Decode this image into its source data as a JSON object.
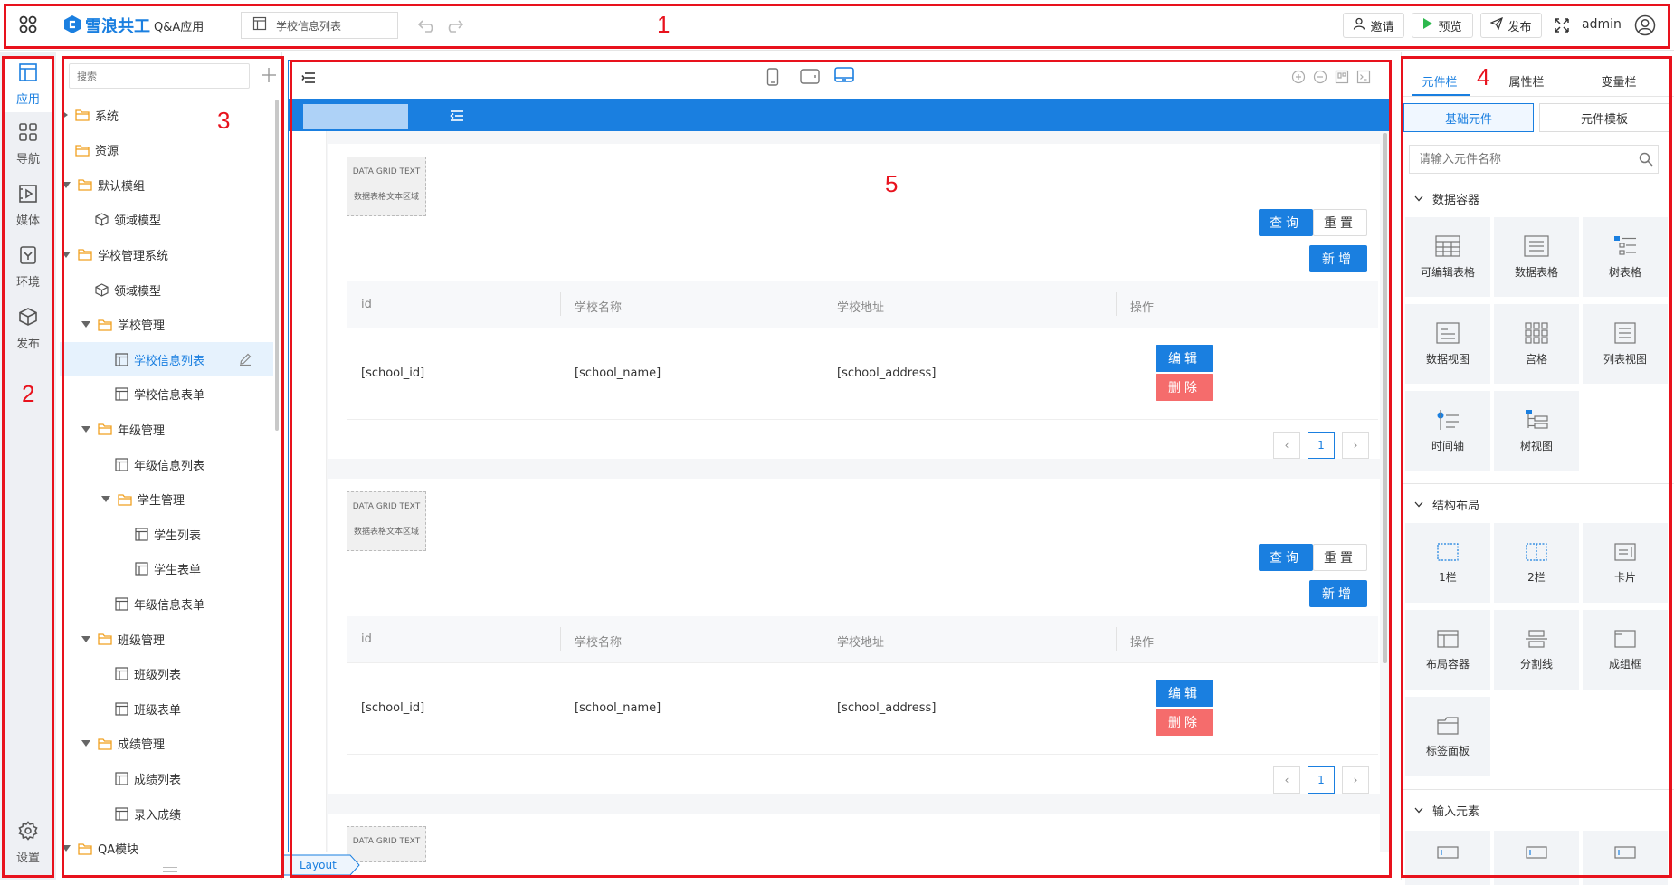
{
  "topbar": {
    "brand": "雪浪共工",
    "app_name": "Q&A应用",
    "doc_tab": "学校信息列表",
    "invite": "邀请",
    "preview": "预览",
    "publish": "发布",
    "user": "admin"
  },
  "leftnav": {
    "items": [
      {
        "label": "应用"
      },
      {
        "label": "导航"
      },
      {
        "label": "媒体"
      },
      {
        "label": "环境"
      },
      {
        "label": "发布"
      }
    ],
    "settings": "设置"
  },
  "tree": {
    "search_placeholder": "搜索",
    "nodes": [
      {
        "label": "系统"
      },
      {
        "label": "资源"
      },
      {
        "label": "默认模组"
      },
      {
        "label": "领域模型"
      },
      {
        "label": "学校管理系统"
      },
      {
        "label": "领域模型"
      },
      {
        "label": "学校管理"
      },
      {
        "label": "学校信息列表"
      },
      {
        "label": "学校信息表单"
      },
      {
        "label": "年级管理"
      },
      {
        "label": "年级信息列表"
      },
      {
        "label": "学生管理"
      },
      {
        "label": "学生列表"
      },
      {
        "label": "学生表单"
      },
      {
        "label": "年级信息表单"
      },
      {
        "label": "班级管理"
      },
      {
        "label": "班级列表"
      },
      {
        "label": "班级表单"
      },
      {
        "label": "成绩管理"
      },
      {
        "label": "成绩列表"
      },
      {
        "label": "录入成绩"
      },
      {
        "label": "QA模块"
      }
    ]
  },
  "canvas": {
    "grid_text_title": "DATA GRID TEXT",
    "grid_text_body": "数据表格文本区域",
    "query": "查询",
    "reset": "重置",
    "add": "新增",
    "columns": [
      "id",
      "学校名称",
      "学校地址",
      "操作"
    ],
    "row": [
      "[school_id]",
      "[school_name]",
      "[school_address]"
    ],
    "edit": "编辑",
    "delete": "删除",
    "page": "1",
    "breadcrumb": "Layout"
  },
  "rightpanel": {
    "tabs": [
      "元件栏",
      "属性栏",
      "变量栏"
    ],
    "subtabs": [
      "基础元件",
      "元件模板"
    ],
    "search_placeholder": "请输入元件名称",
    "sections": [
      {
        "title": "数据容器",
        "items": [
          "可编辑表格",
          "数据表格",
          "树表格",
          "数据视图",
          "宫格",
          "列表视图",
          "时间轴",
          "树视图"
        ]
      },
      {
        "title": "结构布局",
        "items": [
          "1栏",
          "2栏",
          "卡片",
          "布局容器",
          "分割线",
          "成组框",
          "标签面板"
        ]
      },
      {
        "title": "输入元素",
        "items": []
      }
    ]
  },
  "annotations": [
    "1",
    "2",
    "3",
    "4",
    "5"
  ]
}
